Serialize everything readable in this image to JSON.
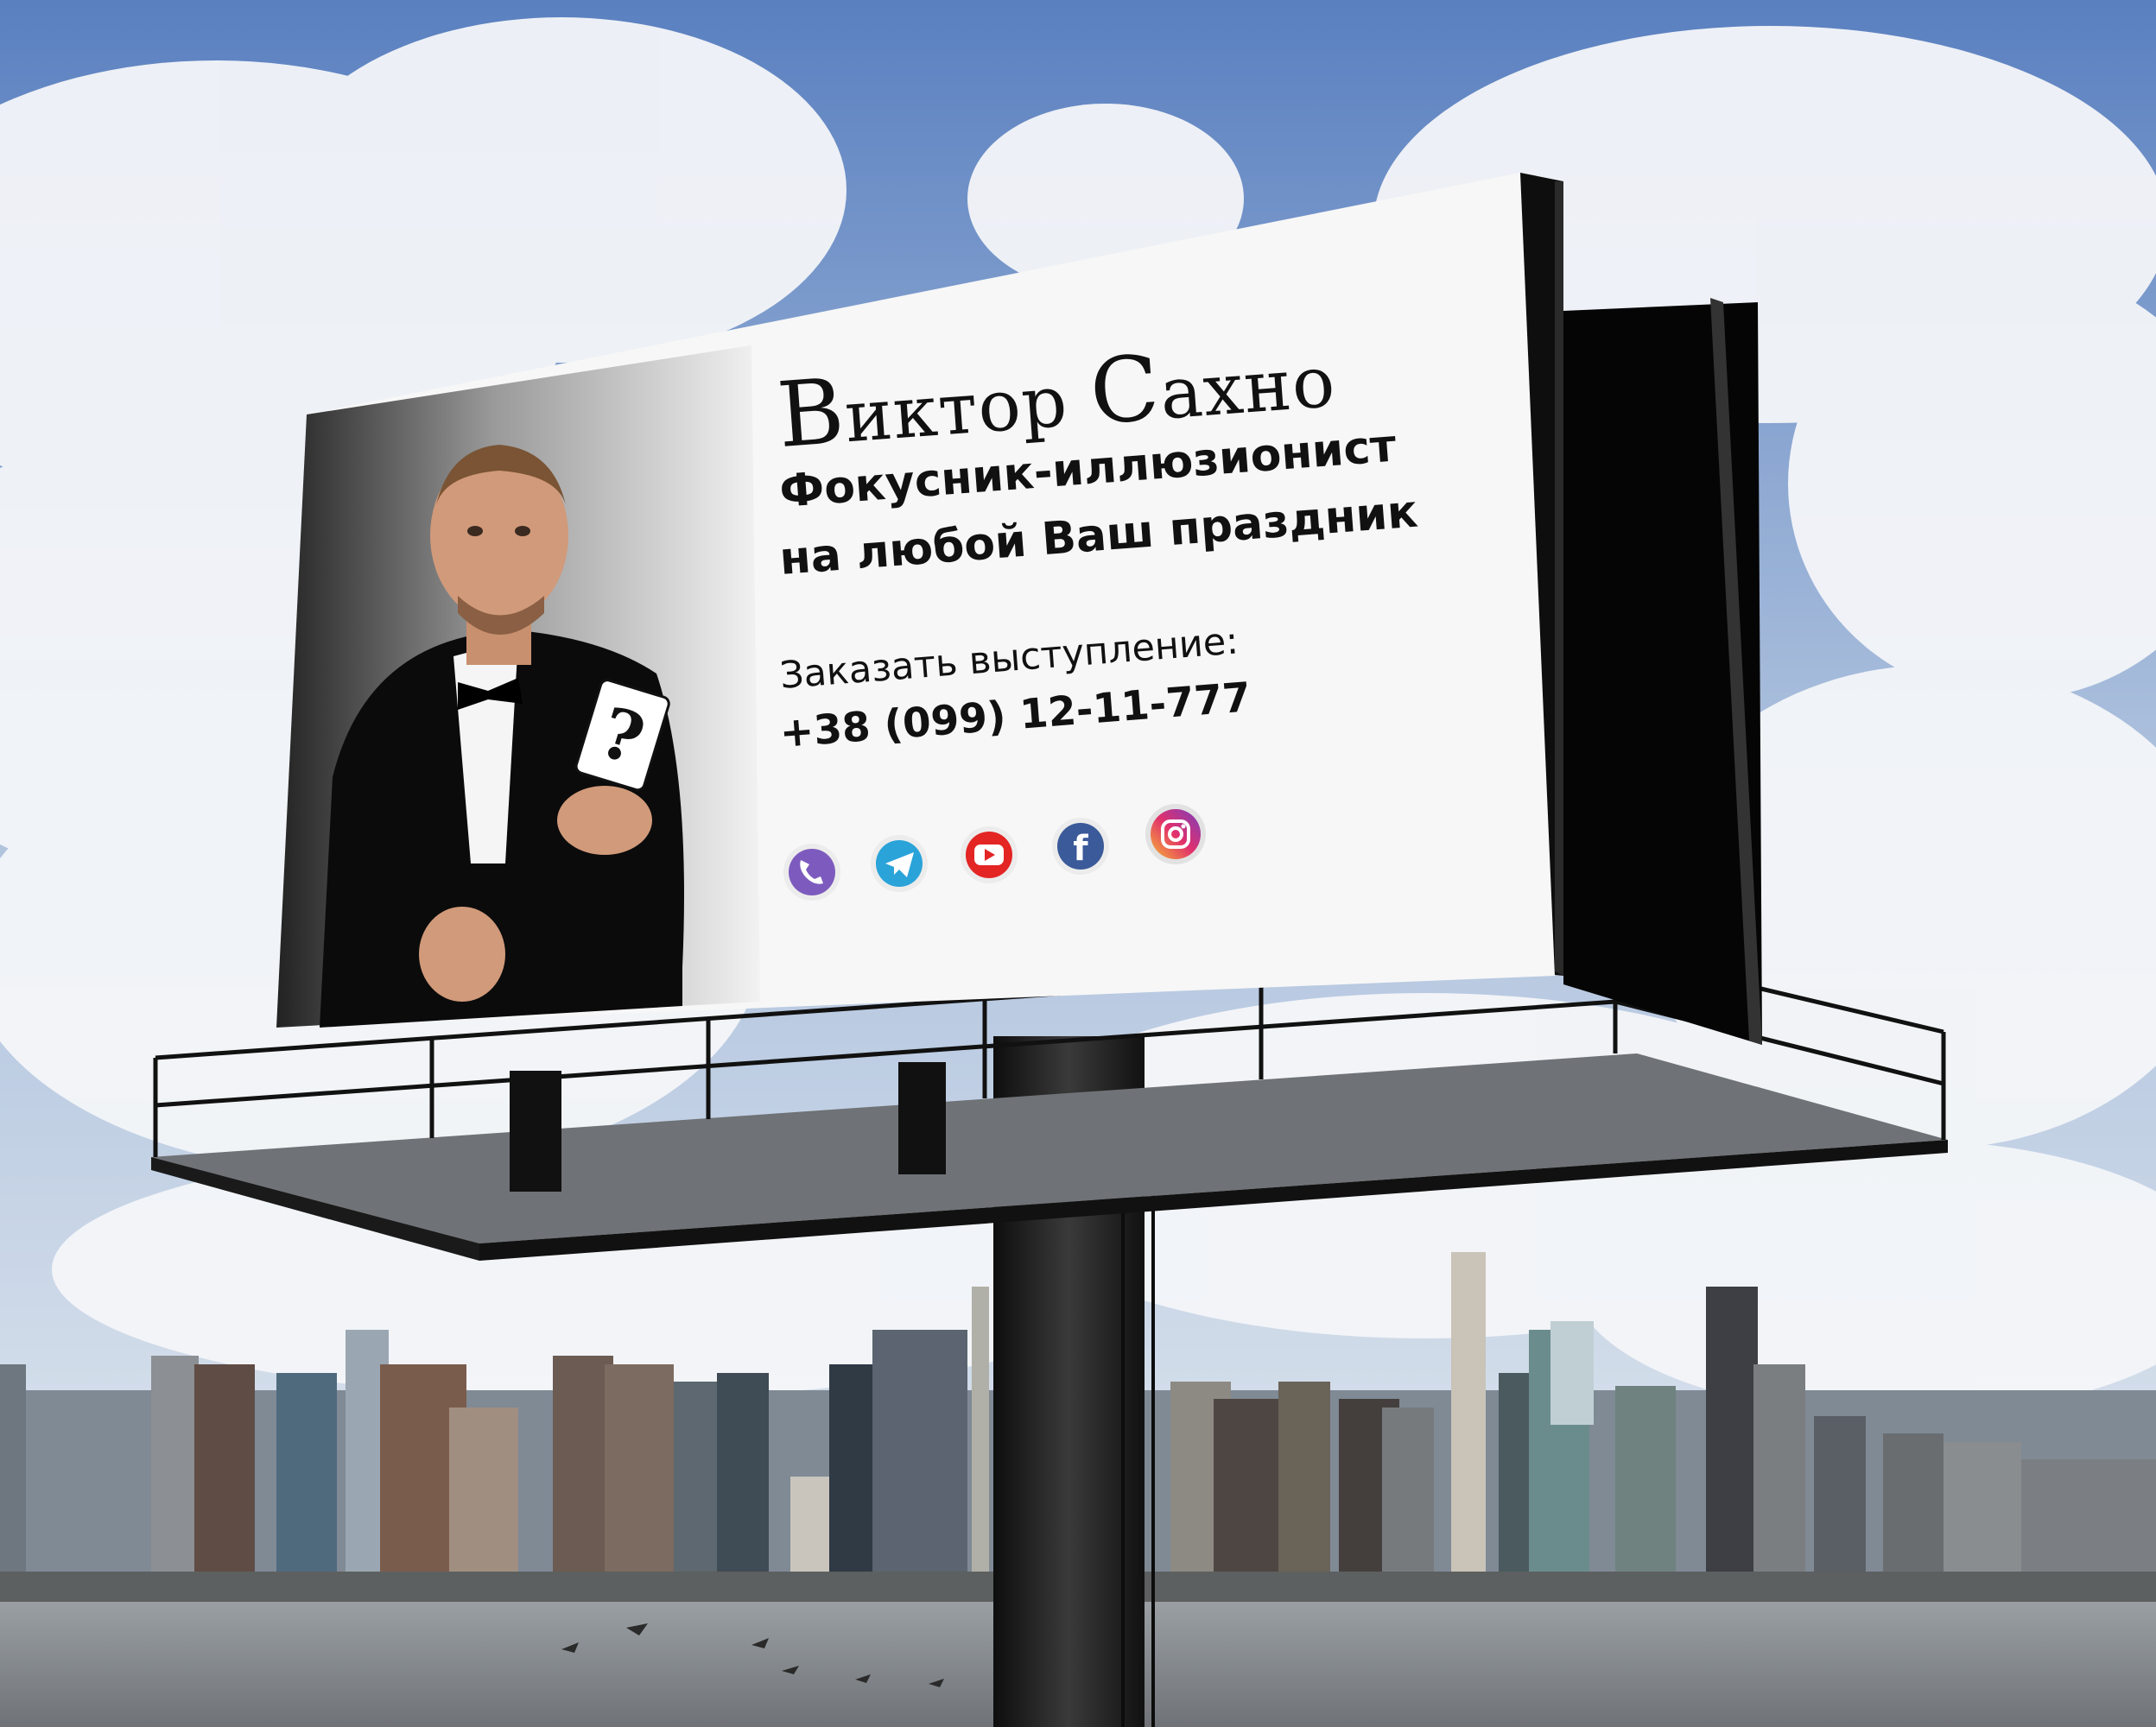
{
  "billboard": {
    "name_initial_1": "В",
    "name_rest_1": "иктор ",
    "name_initial_2": "С",
    "name_rest_2": "ахно",
    "tagline_line1": "Фокусник-иллюзионист",
    "tagline_line2": "на любой Ваш праздник",
    "order_label": "Заказать выступление:",
    "phone": "+38 (099) 12-11-777",
    "card_symbol": "?",
    "social_icons": [
      {
        "icon": "viber-icon",
        "color": "#7d5bbe"
      },
      {
        "icon": "telegram-icon",
        "color": "#2aa3d9"
      },
      {
        "icon": "youtube-icon",
        "color": "#e32524"
      },
      {
        "icon": "facebook-icon",
        "color": "#3b5a9a"
      },
      {
        "icon": "instagram-icon",
        "color": "#d6317a"
      }
    ]
  },
  "colors": {
    "sky": "#6d8fc4",
    "billboard_face": "#f7f7f7",
    "frame": "#1b1b1b",
    "water": "#8a8f93"
  }
}
